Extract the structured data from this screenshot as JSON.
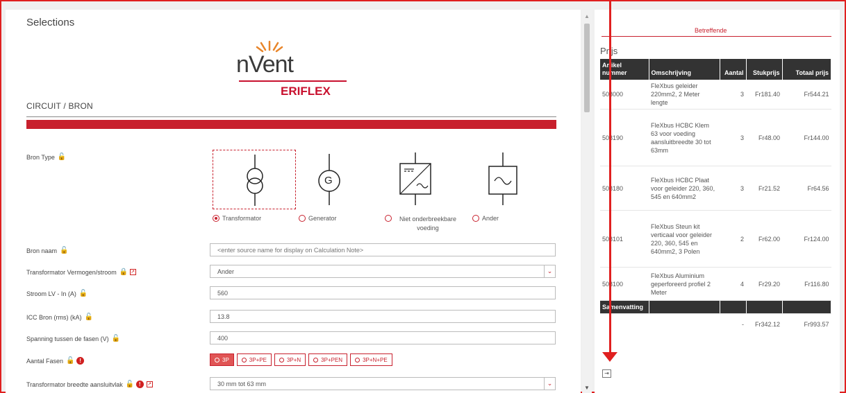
{
  "left": {
    "title": "Selections",
    "logo": {
      "brand": "nVent",
      "sub": "ERIFLEX"
    },
    "section": "CIRCUIT / BRON",
    "bron_type_label": "Bron Type",
    "sources": [
      {
        "label": "Transformator",
        "selected": true
      },
      {
        "label": "Generator",
        "selected": false
      },
      {
        "label": "Niet onderbreekbare voeding",
        "selected": false
      },
      {
        "label": "Ander",
        "selected": false
      }
    ],
    "generator_symbol": "G",
    "fields": {
      "bron_naam": {
        "label": "Bron naam",
        "placeholder": "<enter source name for display on Calculation Note>"
      },
      "vermogen": {
        "label": "Transformator Vermogen/stroom",
        "value": "Ander"
      },
      "stroom": {
        "label": "Stroom LV - In (A)",
        "value": "560"
      },
      "icc": {
        "label": "ICC Bron (rms) (kA)",
        "value": "13.8"
      },
      "spanning": {
        "label": "Spanning tussen de fasen (V)",
        "value": "400"
      },
      "fasen": {
        "label": "Aantal Fasen"
      },
      "breedte": {
        "label": "Transformator breedte aansluitvlak",
        "value": "30 mm tot 63 mm"
      }
    },
    "phases": [
      "3P",
      "3P+PE",
      "3P+N",
      "3P+PEN",
      "3P+N+PE"
    ]
  },
  "right": {
    "tab": "Betreffende",
    "prijs_title": "Prijs",
    "headers": [
      "Artikel nummer",
      "Omschrijving",
      "Aantal",
      "Stukprijs",
      "Totaal prijs"
    ],
    "rows": [
      {
        "art": "508000",
        "desc": "FleXbus geleider 220mm2, 2 Meter lengte",
        "qty": "3",
        "unit": "Fr181.40",
        "total": "Fr544.21"
      },
      {
        "art": "508190",
        "desc": "FleXbus HCBC Klem 63 voor voeding aansluitbreedte 30 tot 63mm",
        "qty": "3",
        "unit": "Fr48.00",
        "total": "Fr144.00"
      },
      {
        "art": "508180",
        "desc": "FleXbus HCBC Plaat voor geleider 220, 360, 545 en 640mm2",
        "qty": "3",
        "unit": "Fr21.52",
        "total": "Fr64.56"
      },
      {
        "art": "508101",
        "desc": "FleXbus Steun kit verticaal voor geleider 220, 360, 545 en 640mm2, 3 Polen",
        "qty": "2",
        "unit": "Fr62.00",
        "total": "Fr124.00"
      },
      {
        "art": "508100",
        "desc": "FleXbus Aluminium geperforeerd profiel 2 Meter",
        "qty": "4",
        "unit": "Fr29.20",
        "total": "Fr116.80"
      }
    ],
    "summary_label": "Samenvatting",
    "summary": {
      "qty": "-",
      "unit": "Fr342.12",
      "total": "Fr993.57"
    }
  },
  "colors": {
    "accent": "#c8202d",
    "table_header": "#333333"
  }
}
